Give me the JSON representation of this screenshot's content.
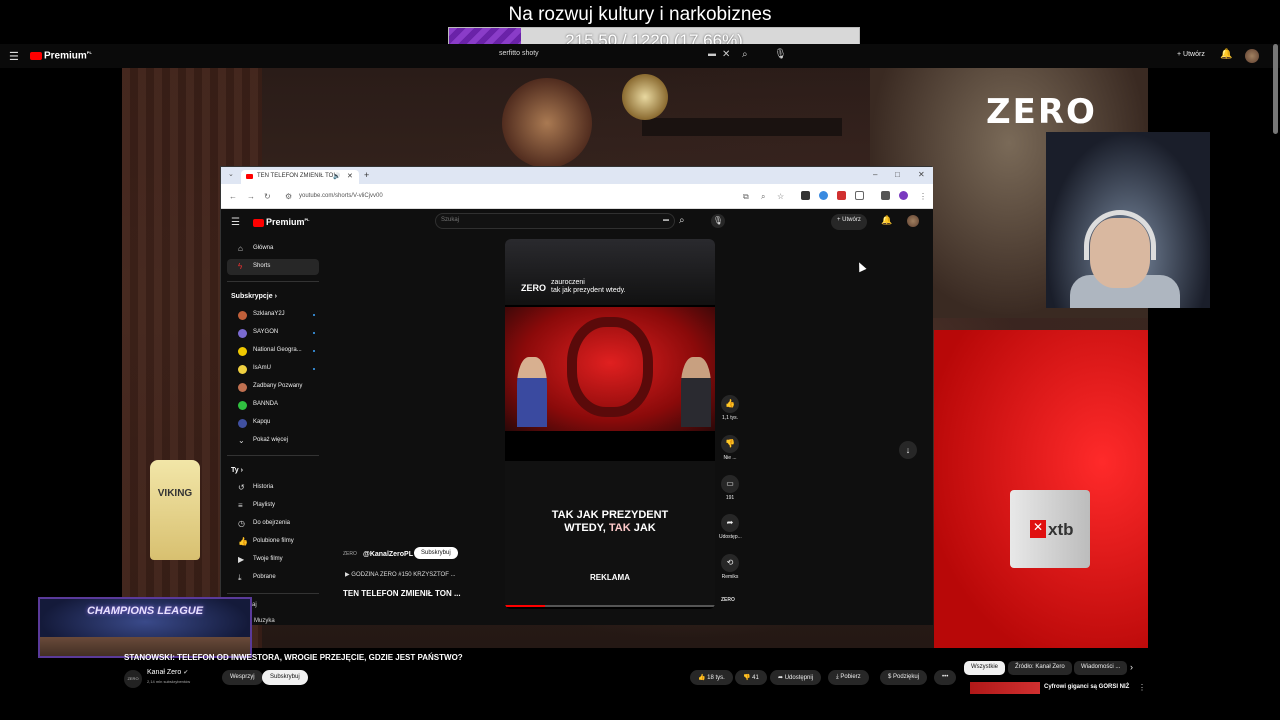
{
  "stream": {
    "title": "Na rozwuj kultury i narkobiznes",
    "goal_text": "215.50 / 1220 (17.66%)",
    "goal_fraction": 0.1766
  },
  "yt_top": {
    "logo": "Premium",
    "logo_sup": "PL",
    "search_text": "serfitto shoty",
    "create_label": "Utwórz"
  },
  "scene": {
    "zero_logo": "ZERO",
    "mug_brand": "xtb",
    "bottle_brand": "VIKING"
  },
  "browser": {
    "tab_title": "TEN TELEFON ZMIENIŁ TO!",
    "url": "youtube.com/shorts/V-vliCjvv00",
    "inner": {
      "logo": "Premium",
      "logo_sup": "PL",
      "search_placeholder": "Szukaj",
      "create_label": "Utwórz",
      "nav": [
        {
          "label": "Główna",
          "icon": "home-icon"
        },
        {
          "label": "Shorts",
          "icon": "shorts-icon"
        }
      ],
      "subs_heading": "Subskrypcje",
      "subs": [
        {
          "label": "SzklanaY2J",
          "color": "#c0603a"
        },
        {
          "label": "SAYGON",
          "color": "#7a6ad0"
        },
        {
          "label": "National Geogra...",
          "color": "#f0c800"
        },
        {
          "label": "IsAmU",
          "color": "#f0d040"
        },
        {
          "label": "Zadbany Pozwany",
          "color": "#c07050"
        },
        {
          "label": "BANNDA",
          "color": "#30c040"
        },
        {
          "label": "Kapqu",
          "color": "#4050a0"
        }
      ],
      "show_more": "Pokaż więcej",
      "you_heading": "Ty",
      "you_items": [
        {
          "label": "Historia",
          "icon": "history-icon"
        },
        {
          "label": "Playlisty",
          "icon": "playlist-icon"
        },
        {
          "label": "Do obejrzenia",
          "icon": "clock-icon"
        },
        {
          "label": "Polubione filmy",
          "icon": "thumb-up-icon"
        },
        {
          "label": "Twoje filmy",
          "icon": "video-icon"
        },
        {
          "label": "Pobrane",
          "icon": "download-icon"
        }
      ],
      "short": {
        "brand": "ZERO",
        "caption_line1": "zauroczeni",
        "caption_line2": "tak jak prezydent wtedy.",
        "subtitle_line1": "TAK JAK PREZYDENT",
        "subtitle_line2a": "WTEDY, ",
        "subtitle_line2b": "TAK",
        "subtitle_line2c": " JAK",
        "ad_label": "REKLAMA",
        "progress": 0.19
      },
      "actions": {
        "like": "1,1 tys.",
        "dislike": "Nie ...",
        "comments": "191",
        "share": "Udostęp...",
        "remix": "Remiks",
        "channel_mini": "ZERO"
      },
      "channel": {
        "logo": "ZERO",
        "name": "@KanalZeroPL",
        "subscribe": "Subskrybuj",
        "link": "▶ GODZINA ZERO #150 KRZYSZTOF ...",
        "title": "TEN TELEFON ZMIENIŁ TON ..."
      }
    }
  },
  "bottom": {
    "title": "STANOWSKI: TELEFON OD INWESTORA, WROGIE PRZEJĘCIE, GDZIE JEST PAŃSTWO?",
    "channel_logo": "ZERO",
    "channel_name": "Kanał Zero",
    "channel_subs": "2,14 mln subskrybentów",
    "join": "Wesprzyj",
    "subscribe": "Subskrybuj",
    "likes": "18 tys.",
    "dislikes": "41",
    "share": "Udostępnij",
    "download": "Pobierz",
    "thanks": "Podziękuj",
    "more": "•••",
    "chips": [
      "Wszystkie",
      "Źródło: Kanał Zero",
      "Wiadomości ..."
    ],
    "rec_title": "Cyfrowi giganci są GORSI NIŻ"
  },
  "overlay": {
    "cl_text": "CHAMPIONS LEAGUE",
    "side1": "aj",
    "side2": "Muzyka"
  }
}
